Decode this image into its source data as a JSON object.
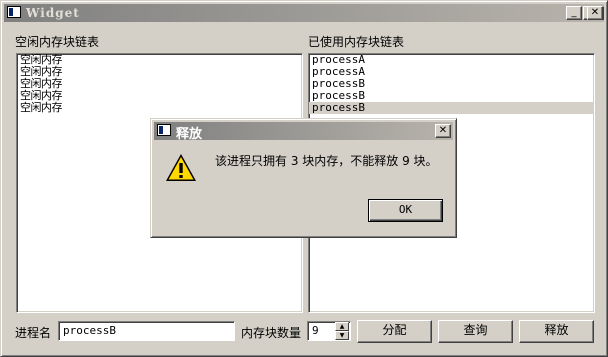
{
  "window": {
    "title": "Widget",
    "minimize_glyph": "_",
    "maximize_glyph": "□",
    "close_glyph": "✕"
  },
  "free_list": {
    "label": "空闲内存块链表",
    "items": [
      "空闲内存",
      "空闲内存",
      "空闲内存",
      "空闲内存",
      "空闲内存"
    ]
  },
  "used_list": {
    "label": "已使用内存块链表",
    "items": [
      "processA",
      "processA",
      "processB",
      "processB",
      "processB"
    ],
    "selected_index": 4
  },
  "controls": {
    "process_name_label": "进程名",
    "process_name_value": "processB",
    "block_count_label": "内存块数量",
    "block_count_value": "9",
    "allocate_button": "分配",
    "query_button": "查询",
    "release_button": "释放"
  },
  "dialog": {
    "title": "释放",
    "message": "该进程只拥有 3 块内存，不能释放 9 块。",
    "ok_button": "OK",
    "close_glyph": "✕",
    "icon": "warning-icon"
  }
}
